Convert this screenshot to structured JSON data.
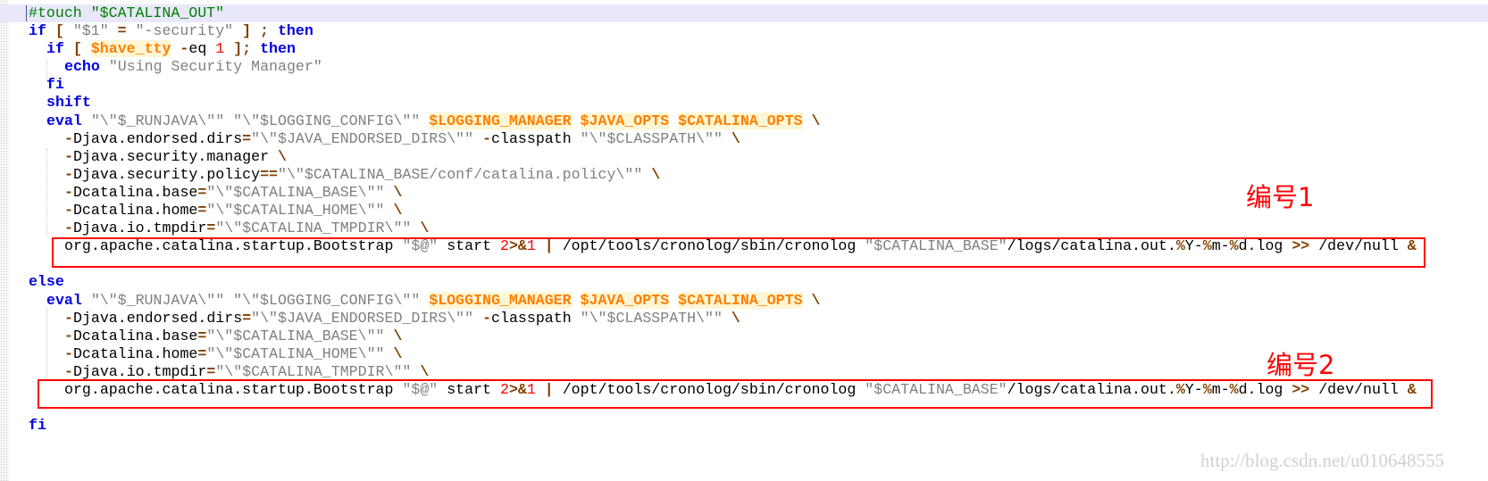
{
  "editor": {
    "current_line": 0,
    "lines": [
      {
        "indent": 0,
        "tokens": [
          {
            "t": "#touch \"$CATALINA_OUT\"",
            "c": "c"
          }
        ]
      },
      {
        "indent": 0,
        "tokens": [
          {
            "t": "if",
            "c": "k"
          },
          {
            "t": " ",
            "c": "p"
          },
          {
            "t": "[",
            "c": "o"
          },
          {
            "t": " ",
            "c": "p"
          },
          {
            "t": "\"$1\"",
            "c": "s"
          },
          {
            "t": " ",
            "c": "p"
          },
          {
            "t": "=",
            "c": "o"
          },
          {
            "t": " ",
            "c": "p"
          },
          {
            "t": "\"-security\"",
            "c": "s"
          },
          {
            "t": " ",
            "c": "p"
          },
          {
            "t": "]",
            "c": "o"
          },
          {
            "t": " ",
            "c": "p"
          },
          {
            "t": ";",
            "c": "o"
          },
          {
            "t": " ",
            "c": "p"
          },
          {
            "t": "then",
            "c": "k"
          }
        ]
      },
      {
        "indent": 2,
        "tokens": [
          {
            "t": "if",
            "c": "k"
          },
          {
            "t": " ",
            "c": "p"
          },
          {
            "t": "[",
            "c": "o"
          },
          {
            "t": " ",
            "c": "p"
          },
          {
            "t": "$have_tty",
            "c": "v"
          },
          {
            "t": " ",
            "c": "p"
          },
          {
            "t": "-",
            "c": "o"
          },
          {
            "t": "eq ",
            "c": "p"
          },
          {
            "t": "1",
            "c": "n"
          },
          {
            "t": " ",
            "c": "p"
          },
          {
            "t": "];",
            "c": "o"
          },
          {
            "t": " ",
            "c": "p"
          },
          {
            "t": "then",
            "c": "k"
          }
        ]
      },
      {
        "indent": 4,
        "tokens": [
          {
            "t": "echo",
            "c": "k"
          },
          {
            "t": " ",
            "c": "p"
          },
          {
            "t": "\"Using Security Manager\"",
            "c": "s"
          }
        ]
      },
      {
        "indent": 2,
        "tokens": [
          {
            "t": "fi",
            "c": "k"
          }
        ]
      },
      {
        "indent": 2,
        "tokens": [
          {
            "t": "shift",
            "c": "k"
          }
        ]
      },
      {
        "indent": 2,
        "tokens": [
          {
            "t": "eval",
            "c": "k"
          },
          {
            "t": " ",
            "c": "p"
          },
          {
            "t": "\"\\\"$_RUNJAVA\\\"\"",
            "c": "s"
          },
          {
            "t": " ",
            "c": "p"
          },
          {
            "t": "\"\\\"$LOGGING_CONFIG\\\"\"",
            "c": "s"
          },
          {
            "t": " ",
            "c": "p"
          },
          {
            "t": "$LOGGING_MANAGER",
            "c": "v"
          },
          {
            "t": " ",
            "c": "p"
          },
          {
            "t": "$JAVA_OPTS",
            "c": "v"
          },
          {
            "t": " ",
            "c": "p"
          },
          {
            "t": "$CATALINA_OPTS",
            "c": "v"
          },
          {
            "t": " ",
            "c": "p"
          },
          {
            "t": "\\",
            "c": "o"
          }
        ]
      },
      {
        "indent": 4,
        "tokens": [
          {
            "t": "-",
            "c": "o"
          },
          {
            "t": "Djava.endorsed.dirs",
            "c": "p"
          },
          {
            "t": "=",
            "c": "o"
          },
          {
            "t": "\"\\\"$JAVA_ENDORSED_DIRS\\\"\"",
            "c": "s"
          },
          {
            "t": " ",
            "c": "p"
          },
          {
            "t": "-",
            "c": "o"
          },
          {
            "t": "classpath ",
            "c": "p"
          },
          {
            "t": "\"\\\"$CLASSPATH\\\"\"",
            "c": "s"
          },
          {
            "t": " ",
            "c": "p"
          },
          {
            "t": "\\",
            "c": "o"
          }
        ]
      },
      {
        "indent": 4,
        "tokens": [
          {
            "t": "-",
            "c": "o"
          },
          {
            "t": "Djava.security.manager ",
            "c": "p"
          },
          {
            "t": "\\",
            "c": "o"
          }
        ]
      },
      {
        "indent": 4,
        "tokens": [
          {
            "t": "-",
            "c": "o"
          },
          {
            "t": "Djava.security.policy",
            "c": "p"
          },
          {
            "t": "==",
            "c": "o"
          },
          {
            "t": "\"\\\"$CATALINA_BASE/conf/catalina.policy\\\"\"",
            "c": "s"
          },
          {
            "t": " ",
            "c": "p"
          },
          {
            "t": "\\",
            "c": "o"
          }
        ]
      },
      {
        "indent": 4,
        "tokens": [
          {
            "t": "-",
            "c": "o"
          },
          {
            "t": "Dcatalina.base",
            "c": "p"
          },
          {
            "t": "=",
            "c": "o"
          },
          {
            "t": "\"\\\"$CATALINA_BASE\\\"\"",
            "c": "s"
          },
          {
            "t": " ",
            "c": "p"
          },
          {
            "t": "\\",
            "c": "o"
          }
        ]
      },
      {
        "indent": 4,
        "tokens": [
          {
            "t": "-",
            "c": "o"
          },
          {
            "t": "Dcatalina.home",
            "c": "p"
          },
          {
            "t": "=",
            "c": "o"
          },
          {
            "t": "\"\\\"$CATALINA_HOME\\\"\"",
            "c": "s"
          },
          {
            "t": " ",
            "c": "p"
          },
          {
            "t": "\\",
            "c": "o"
          }
        ]
      },
      {
        "indent": 4,
        "tokens": [
          {
            "t": "-",
            "c": "o"
          },
          {
            "t": "Djava.io.tmpdir",
            "c": "p"
          },
          {
            "t": "=",
            "c": "o"
          },
          {
            "t": "\"\\\"$CATALINA_TMPDIR\\\"\"",
            "c": "s"
          },
          {
            "t": " ",
            "c": "p"
          },
          {
            "t": "\\",
            "c": "o"
          }
        ]
      },
      {
        "indent": 4,
        "tokens": [
          {
            "t": "org.apache.catalina.startup.Bootstrap ",
            "c": "p"
          },
          {
            "t": "\"$@\"",
            "c": "s"
          },
          {
            "t": " start ",
            "c": "p"
          },
          {
            "t": "2",
            "c": "n"
          },
          {
            "t": ">&",
            "c": "o"
          },
          {
            "t": "1",
            "c": "n"
          },
          {
            "t": " ",
            "c": "p"
          },
          {
            "t": "|",
            "c": "o"
          },
          {
            "t": " /opt/tools/cronolog/sbin/cronolog ",
            "c": "p"
          },
          {
            "t": "\"$CATALINA_BASE\"",
            "c": "s"
          },
          {
            "t": "/logs/catalina.out.",
            "c": "p"
          },
          {
            "t": "%",
            "c": "o"
          },
          {
            "t": "Y-",
            "c": "p"
          },
          {
            "t": "%",
            "c": "o"
          },
          {
            "t": "m-",
            "c": "p"
          },
          {
            "t": "%",
            "c": "o"
          },
          {
            "t": "d.log ",
            "c": "p"
          },
          {
            "t": ">>",
            "c": "o"
          },
          {
            "t": " /dev/null ",
            "c": "p"
          },
          {
            "t": "&",
            "c": "o"
          }
        ]
      },
      {
        "indent": 0,
        "tokens": []
      },
      {
        "indent": 0,
        "tokens": [
          {
            "t": "else",
            "c": "k"
          }
        ]
      },
      {
        "indent": 2,
        "tokens": [
          {
            "t": "eval",
            "c": "k"
          },
          {
            "t": " ",
            "c": "p"
          },
          {
            "t": "\"\\\"$_RUNJAVA\\\"\"",
            "c": "s"
          },
          {
            "t": " ",
            "c": "p"
          },
          {
            "t": "\"\\\"$LOGGING_CONFIG\\\"\"",
            "c": "s"
          },
          {
            "t": " ",
            "c": "p"
          },
          {
            "t": "$LOGGING_MANAGER",
            "c": "v"
          },
          {
            "t": " ",
            "c": "p"
          },
          {
            "t": "$JAVA_OPTS",
            "c": "v"
          },
          {
            "t": " ",
            "c": "p"
          },
          {
            "t": "$CATALINA_OPTS",
            "c": "v"
          },
          {
            "t": " ",
            "c": "p"
          },
          {
            "t": "\\",
            "c": "o"
          }
        ]
      },
      {
        "indent": 4,
        "tokens": [
          {
            "t": "-",
            "c": "o"
          },
          {
            "t": "Djava.endorsed.dirs",
            "c": "p"
          },
          {
            "t": "=",
            "c": "o"
          },
          {
            "t": "\"\\\"$JAVA_ENDORSED_DIRS\\\"\"",
            "c": "s"
          },
          {
            "t": " ",
            "c": "p"
          },
          {
            "t": "-",
            "c": "o"
          },
          {
            "t": "classpath ",
            "c": "p"
          },
          {
            "t": "\"\\\"$CLASSPATH\\\"\"",
            "c": "s"
          },
          {
            "t": " ",
            "c": "p"
          },
          {
            "t": "\\",
            "c": "o"
          }
        ]
      },
      {
        "indent": 4,
        "tokens": [
          {
            "t": "-",
            "c": "o"
          },
          {
            "t": "Dcatalina.base",
            "c": "p"
          },
          {
            "t": "=",
            "c": "o"
          },
          {
            "t": "\"\\\"$CATALINA_BASE\\\"\"",
            "c": "s"
          },
          {
            "t": " ",
            "c": "p"
          },
          {
            "t": "\\",
            "c": "o"
          }
        ]
      },
      {
        "indent": 4,
        "tokens": [
          {
            "t": "-",
            "c": "o"
          },
          {
            "t": "Dcatalina.home",
            "c": "p"
          },
          {
            "t": "=",
            "c": "o"
          },
          {
            "t": "\"\\\"$CATALINA_HOME\\\"\"",
            "c": "s"
          },
          {
            "t": " ",
            "c": "p"
          },
          {
            "t": "\\",
            "c": "o"
          }
        ]
      },
      {
        "indent": 4,
        "tokens": [
          {
            "t": "-",
            "c": "o"
          },
          {
            "t": "Djava.io.tmpdir",
            "c": "p"
          },
          {
            "t": "=",
            "c": "o"
          },
          {
            "t": "\"\\\"$CATALINA_TMPDIR\\\"\"",
            "c": "s"
          },
          {
            "t": " ",
            "c": "p"
          },
          {
            "t": "\\",
            "c": "o"
          }
        ]
      },
      {
        "indent": 4,
        "tokens": [
          {
            "t": "org.apache.catalina.startup.Bootstrap ",
            "c": "p"
          },
          {
            "t": "\"$@\"",
            "c": "s"
          },
          {
            "t": " start ",
            "c": "p"
          },
          {
            "t": "2",
            "c": "n"
          },
          {
            "t": ">&",
            "c": "o"
          },
          {
            "t": "1",
            "c": "n"
          },
          {
            "t": " ",
            "c": "p"
          },
          {
            "t": "|",
            "c": "o"
          },
          {
            "t": " /opt/tools/cronolog/sbin/cronolog ",
            "c": "p"
          },
          {
            "t": "\"$CATALINA_BASE\"",
            "c": "s"
          },
          {
            "t": "/logs/catalina.out.",
            "c": "p"
          },
          {
            "t": "%",
            "c": "o"
          },
          {
            "t": "Y-",
            "c": "p"
          },
          {
            "t": "%",
            "c": "o"
          },
          {
            "t": "m-",
            "c": "p"
          },
          {
            "t": "%",
            "c": "o"
          },
          {
            "t": "d.log ",
            "c": "p"
          },
          {
            "t": ">>",
            "c": "o"
          },
          {
            "t": " /dev/null ",
            "c": "p"
          },
          {
            "t": "&",
            "c": "o"
          }
        ]
      },
      {
        "indent": 0,
        "tokens": []
      },
      {
        "indent": 0,
        "tokens": [
          {
            "t": "fi",
            "c": "k"
          }
        ]
      }
    ]
  },
  "annotations": {
    "label1": "编号1",
    "label2": "编号2",
    "highlight_color": "#ff0000"
  },
  "colors": {
    "keyword": "#0000e0",
    "string": "#808080",
    "variable": "#ff8000",
    "operator": "#804000",
    "number": "#ff0000",
    "comment": "#008000",
    "current_line_bg": "#e8e8fa"
  },
  "watermark": "http://blog.csdn.net/u010648555"
}
